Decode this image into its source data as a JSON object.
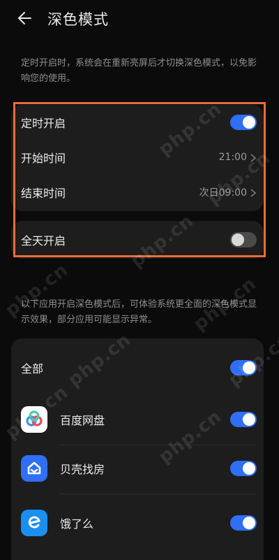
{
  "header": {
    "title": "深色模式"
  },
  "description_schedule": "定时开启时，系统会在重新亮屏后才切换深色模式，以免影响您的使用。",
  "schedule": {
    "enable_label": "定时开启",
    "enable_state": "on",
    "start_label": "开始时间",
    "start_value": "21:00",
    "end_label": "结束时间",
    "end_value": "次日09:00"
  },
  "allday": {
    "label": "全天开启",
    "state": "off"
  },
  "description_apps": "以下应用开启深色模式后，可体验系统更全面的深色模式显示效果，部分应用可能显示异常。",
  "apps": {
    "all_label": "全部",
    "all_state": "on",
    "items": [
      {
        "label": "百度网盘",
        "icon": "baidu-netdisk-icon",
        "state": "on"
      },
      {
        "label": "贝壳找房",
        "icon": "beike-icon",
        "state": "on"
      },
      {
        "label": "饿了么",
        "icon": "eleme-icon",
        "state": "on"
      }
    ]
  },
  "watermark": "php.cn",
  "colors": {
    "background": "#0b0b0b",
    "card": "#1d1d1d",
    "toggle_on": "#2f6ff5",
    "toggle_off": "#4a4a4a",
    "highlight": "#e96b3b"
  }
}
